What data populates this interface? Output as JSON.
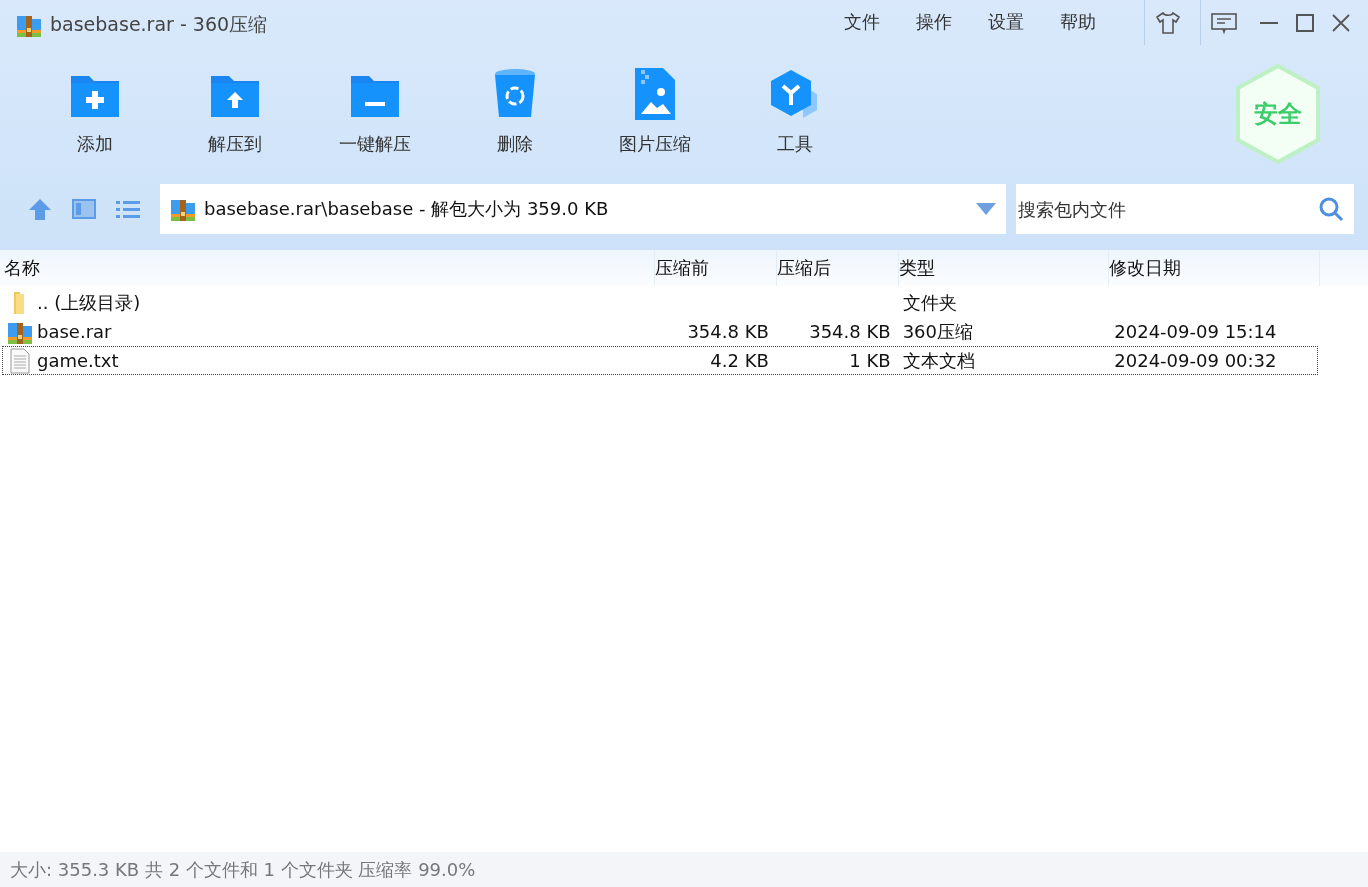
{
  "window": {
    "title": "basebase.rar - 360压缩"
  },
  "menu": [
    "文件",
    "操作",
    "设置",
    "帮助"
  ],
  "toolbar": [
    {
      "kind": "add",
      "label": "添加"
    },
    {
      "kind": "extract",
      "label": "解压到"
    },
    {
      "kind": "oneclick",
      "label": "一键解压"
    },
    {
      "kind": "delete",
      "label": "删除"
    },
    {
      "kind": "image",
      "label": "图片压缩"
    },
    {
      "kind": "tools",
      "label": "工具"
    }
  ],
  "security_badge": "安全",
  "address": {
    "path": "basebase.rar\\basebase - 解包大小为 359.0 KB"
  },
  "search": {
    "placeholder": "搜索包内文件"
  },
  "table": {
    "columns": [
      "名称",
      "压缩前",
      "压缩后",
      "类型",
      "修改日期"
    ],
    "rows": [
      {
        "kind": "folder",
        "name": ".. (上级目录)",
        "size": "",
        "packed": "",
        "type": "文件夹",
        "modified": "",
        "selected": false
      },
      {
        "kind": "archive",
        "name": "base.rar",
        "size": "354.8 KB",
        "packed": "354.8 KB",
        "type": "360压缩",
        "modified": "2024-09-09 15:14",
        "selected": false
      },
      {
        "kind": "text",
        "name": "game.txt",
        "size": "4.2 KB",
        "packed": "1 KB",
        "type": "文本文档",
        "modified": "2024-09-09 00:32",
        "selected": true
      }
    ]
  },
  "status_bar": "大小: 355.3 KB 共 2 个文件和 1 个文件夹 压缩率 99.0%"
}
